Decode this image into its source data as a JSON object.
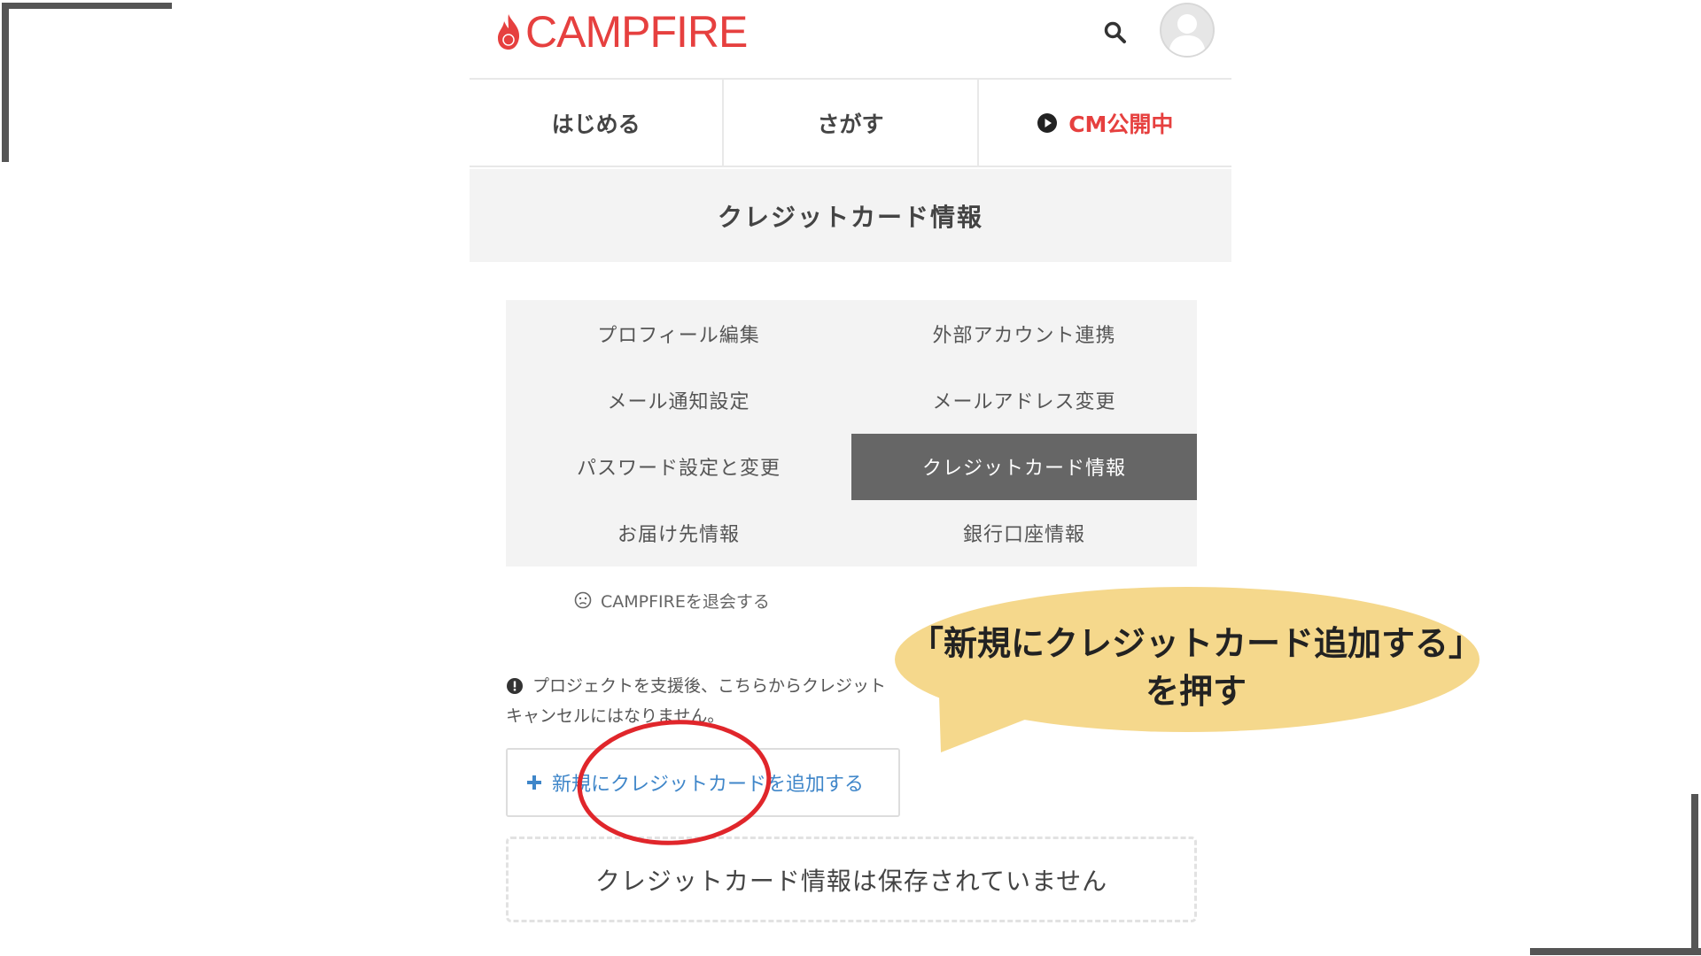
{
  "header": {
    "logo_text": "CAMPFIRE",
    "brand_color": "#e6403f",
    "search_icon": "search-icon",
    "avatar_icon": "user-avatar-icon"
  },
  "nav": {
    "items": [
      {
        "label": "はじめる"
      },
      {
        "label": "さがす"
      },
      {
        "label": "CM公開中",
        "icon": "play-circle-icon"
      }
    ]
  },
  "page": {
    "title": "クレジットカード情報"
  },
  "settings_menu": {
    "items": [
      {
        "label": "プロフィール編集",
        "active": false
      },
      {
        "label": "外部アカウント連携",
        "active": false
      },
      {
        "label": "メール通知設定",
        "active": false
      },
      {
        "label": "メールアドレス変更",
        "active": false
      },
      {
        "label": "パスワード設定と変更",
        "active": false
      },
      {
        "label": "クレジットカード情報",
        "active": true
      },
      {
        "label": "お届け先情報",
        "active": false
      },
      {
        "label": "銀行口座情報",
        "active": false
      }
    ],
    "withdraw_label": "CAMPFIREを退会する"
  },
  "notice": {
    "line1": "プロジェクトを支援後、こちらからクレジット",
    "line2": "キャンセルにはなりません。"
  },
  "actions": {
    "add_card_label": "新規にクレジットカードを追加する",
    "link_color": "#3f86c9"
  },
  "empty_state": {
    "text": "クレジットカード情報は保存されていません"
  },
  "annotation": {
    "line1": "「新規にクレジットカード追加する」",
    "line2": "を押す",
    "bubble_color": "#f5d88c",
    "circle_color": "#e0262b"
  }
}
